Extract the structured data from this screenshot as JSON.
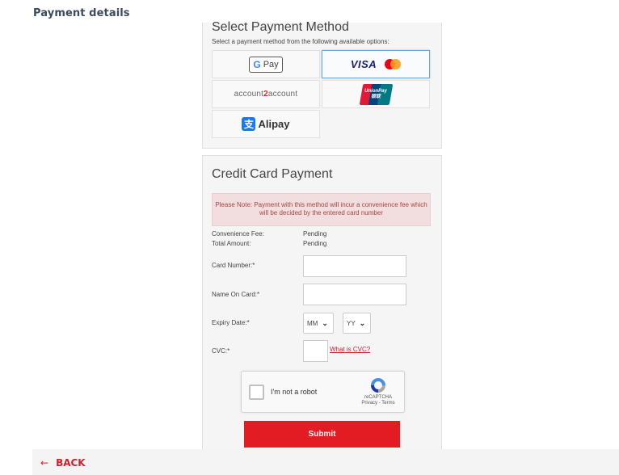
{
  "header": {
    "title": "Payment details"
  },
  "select_payment": {
    "heading": "Select Payment Method",
    "subtitle": "Select a payment method from the following available options:",
    "methods": [
      {
        "name": "Google Pay",
        "label": "Pay",
        "selected": false
      },
      {
        "name": "Visa / Mastercard",
        "label": "VISA",
        "selected": true
      },
      {
        "name": "account2account",
        "label_pre": "account",
        "label_mid": "2",
        "label_post": "account",
        "selected": false
      },
      {
        "name": "UnionPay",
        "label": "UnionPay",
        "label_cn": "银联",
        "selected": false
      },
      {
        "name": "Alipay",
        "label": "Alipay",
        "selected": false
      }
    ]
  },
  "credit_card": {
    "heading": "Credit Card Payment",
    "notice": "Please Note: Payment with this method will incur a convenience fee which will be decided by the entered card number",
    "convenience_fee_label": "Convenience Fee:",
    "convenience_fee_value": "Pending",
    "total_amount_label": "Total Amount:",
    "total_amount_value": "Pending",
    "card_number_label": "Card Number:*",
    "card_number_value": "",
    "name_on_card_label": "Name On Card:*",
    "name_on_card_value": "",
    "expiry_label": "Expiry Date:*",
    "expiry_month": "MM",
    "expiry_year": "YY",
    "cvc_label": "CVC:*",
    "cvc_value": "",
    "cvc_link": "What is CVC?",
    "submit_label": "Submit"
  },
  "recaptcha": {
    "label": "I'm not a robot",
    "brand": "reCAPTCHA",
    "privacy": "Privacy",
    "separator": " - ",
    "terms": "Terms"
  },
  "footer": {
    "back_label": "BACK",
    "back_arrow": "←"
  },
  "colors": {
    "accent_red": "#e31b23",
    "notice_bg": "#f2dede",
    "title": "#3c4a5c",
    "selected_border": "#6ea7d8"
  }
}
